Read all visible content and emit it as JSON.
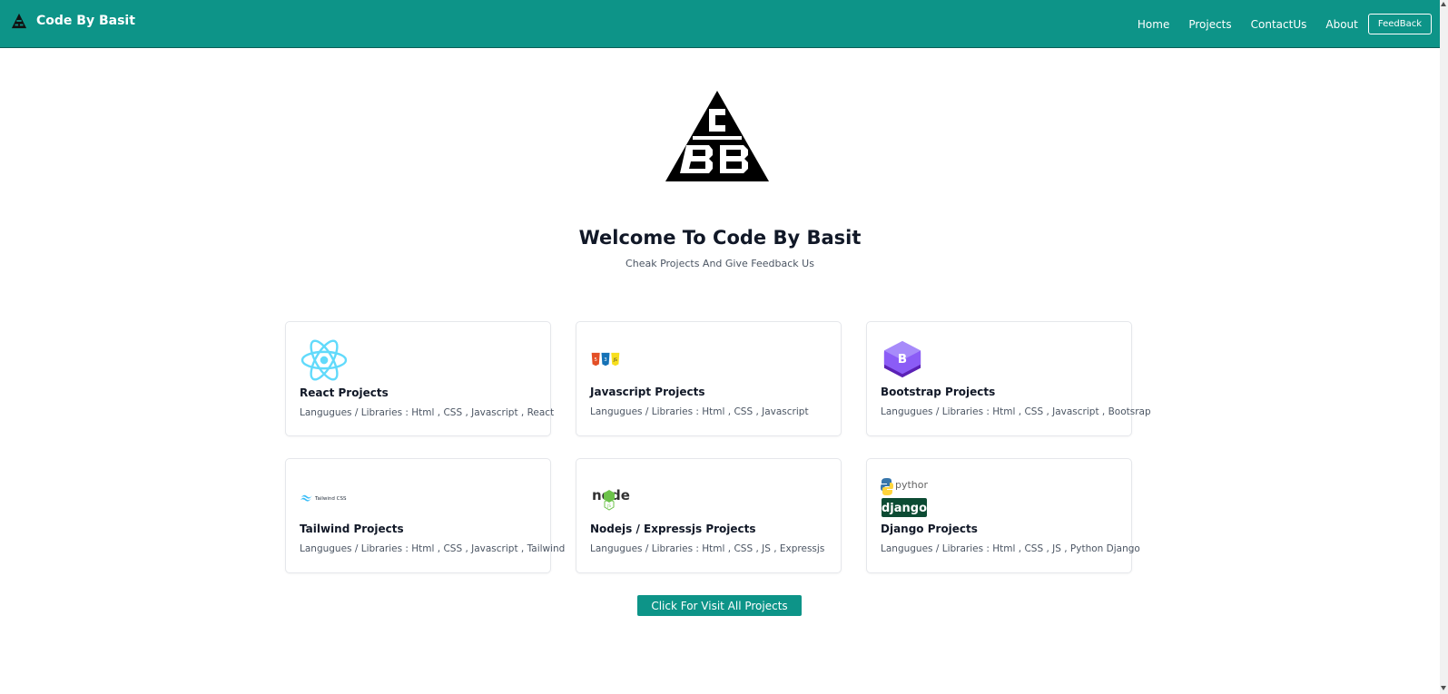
{
  "navbar": {
    "brand": "Code By Basit",
    "links": [
      "Home",
      "Projects",
      "ContactUs",
      "About"
    ],
    "feedback_label": "FeedBack"
  },
  "hero": {
    "title": "Welcome To Code By Basit",
    "subtitle": "Cheak Projects And Give Feedback Us"
  },
  "cards": [
    {
      "title": "React Projects",
      "desc": "Langugues / Libraries : Html , CSS , Javascript , React",
      "icon": "react-icon"
    },
    {
      "title": "Javascript Projects",
      "desc": "Langugues / Libraries : Html , CSS , Javascript",
      "icon": "html-css-js-icon"
    },
    {
      "title": "Bootstrap Projects",
      "desc": "Langugues / Libraries : Html , CSS , Javascript , Bootsrap",
      "icon": "bootstrap-icon"
    },
    {
      "title": "Tailwind Projects",
      "desc": "Langugues / Libraries : Html , CSS , Javascript , Tailwind",
      "icon": "tailwind-icon",
      "icon_text": "Tailwind CSS"
    },
    {
      "title": "Nodejs / Expressjs Projects",
      "desc": "Langugues / Libraries : Html , CSS , JS , Expressjs",
      "icon": "nodejs-icon",
      "icon_text": "node"
    },
    {
      "title": "Django Projects",
      "desc": "Langugues / Libraries : Html , CSS , JS , Python Django",
      "icon": "python-django-icon",
      "icon_text_top": "python",
      "icon_text_bottom": "django"
    }
  ],
  "cta_label": "Click For Visit All Projects",
  "colors": {
    "accent": "#0d9488",
    "bootstrap": "#7e3fe8",
    "react": "#61dafb"
  }
}
